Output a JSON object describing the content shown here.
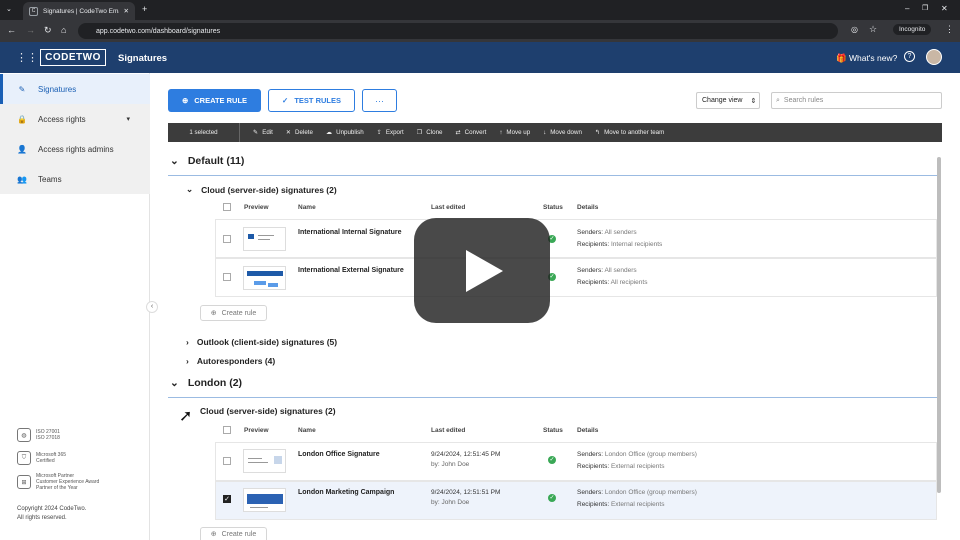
{
  "browser": {
    "tab_title": "Signatures | CodeTwo Email Si...",
    "tab_close": "✕",
    "new_tab": "+",
    "url": "app.codetwo.com/dashboard/signatures",
    "incognito_label": "Incognito"
  },
  "app": {
    "logo_text": "CODETWO",
    "title": "Signatures",
    "whats_new": "What's new?",
    "help": "?",
    "brand_color": "#1e3f6e",
    "accent_color": "#2e7de0"
  },
  "sidebar": {
    "items": [
      {
        "label": "Signatures",
        "icon": "signature-icon",
        "glyph": "✎",
        "active": true
      },
      {
        "label": "Access rights",
        "icon": "lock-icon",
        "glyph": "🔒",
        "has_caret": true,
        "caret": "▾"
      },
      {
        "label": "Access rights admins",
        "icon": "person-icon",
        "glyph": "👤"
      },
      {
        "label": "Teams",
        "icon": "team-icon",
        "glyph": "👥"
      }
    ],
    "certs": [
      {
        "line1": "ISO 27001",
        "line2": "ISO 27018"
      },
      {
        "line1": "Microsoft 365",
        "line2": "Certified"
      },
      {
        "line1": "Microsoft Partner",
        "line2": "Customer Experience Award",
        "line3": "Partner of the Year"
      }
    ],
    "copyright_1": "Copyright 2024 CodeTwo.",
    "copyright_2": "All rights reserved.",
    "collapse_glyph": "‹"
  },
  "actions": {
    "create_rule": "CREATE RULE",
    "test_rules": "TEST RULES",
    "more": "···",
    "change_view": "Change view",
    "search_placeholder": "Search rules"
  },
  "toolbar": {
    "selected": "1 selected",
    "items": [
      "Edit",
      "Delete",
      "Unpublish",
      "Export",
      "Clone",
      "Convert",
      "Move up",
      "Move down",
      "Move to another team"
    ]
  },
  "groups": {
    "default": {
      "title": "Default (11)",
      "cloud": "Cloud (server-side) signatures (2)",
      "outlook": "Outlook (client-side) signatures (5)",
      "autoresponders": "Autoresponders (4)"
    },
    "london": {
      "title": "London (2)",
      "cloud": "Cloud (server-side) signatures (2)"
    }
  },
  "columns": {
    "preview": "Preview",
    "name": "Name",
    "last_edited": "Last edited",
    "status": "Status",
    "details": "Details"
  },
  "labels": {
    "senders": "Senders:",
    "recipients": "Recipients:",
    "create_rule": "Create rule"
  },
  "rows": {
    "default": [
      {
        "name": "International Internal Signature",
        "senders": "All senders",
        "recipients": "Internal recipients"
      },
      {
        "name": "International External Signature",
        "senders": "All senders",
        "recipients": "All recipients"
      }
    ],
    "london": [
      {
        "name": "London Office Signature",
        "date": "9/24/2024, 12:51:45 PM",
        "by": "by: John Doe",
        "senders": "London Office (group members)",
        "recipients": "External recipients",
        "checked": false
      },
      {
        "name": "London Marketing Campaign",
        "date": "9/24/2024, 12:51:51 PM",
        "by": "by: John Doe",
        "senders": "London Office (group members)",
        "recipients": "External recipients",
        "checked": true
      }
    ]
  },
  "status_icon": "check-circle-icon"
}
